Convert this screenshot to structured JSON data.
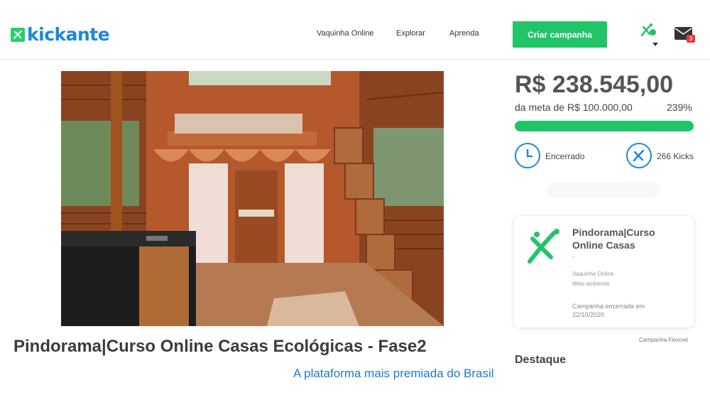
{
  "brand": {
    "name": "kickante",
    "color": "#1e88d8",
    "accent": "#21c467"
  },
  "nav": {
    "items": [
      "Vaquinha Online",
      "Explorar",
      "Aprenda"
    ]
  },
  "header": {
    "create_button": "Criar campanha",
    "mail_count": "3",
    "mail_icon": "envelope-icon",
    "user_icon": "user-avatar-icon"
  },
  "hero": {
    "image_description_icon": "tiny-house-interior-photo",
    "prev_icon": "chevron-left-icon",
    "next_icon": "chevron-right-icon"
  },
  "campaign": {
    "title": "Pindorama|Curso Online Casas Ecológicas - Fase2",
    "tagline": "A plataforma mais premiada do Brasil"
  },
  "funding": {
    "amount": "R$ 238.545,00",
    "goal_text": "da meta de R$ 100.000,00",
    "percent_text": "239%",
    "progress_fraction": 1.0,
    "status": "Encerrado",
    "kicks": "266 Kicks"
  },
  "card": {
    "name": "Pindorama|Curso Online Casas",
    "dash": "-",
    "category1": "Vaquinha Online",
    "category2": "Meio ambiente",
    "ended": "Campanha encerrada em 22/10/2020"
  },
  "flex_label": "Campanha Flexível",
  "destaque": "Destaque"
}
